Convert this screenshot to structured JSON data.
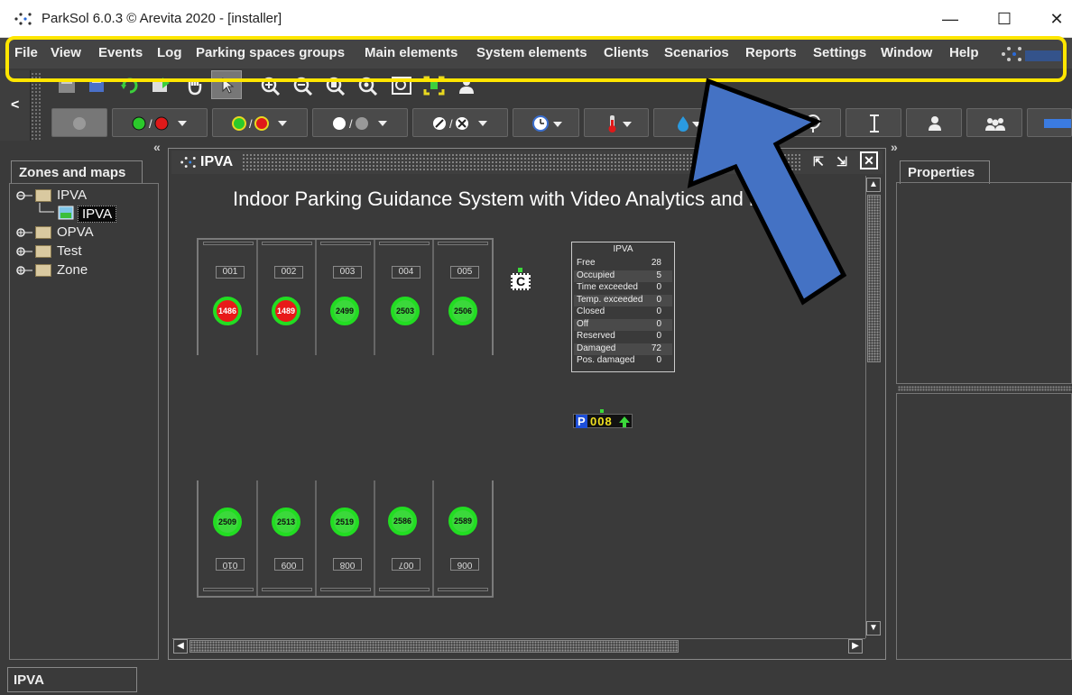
{
  "window": {
    "title": "ParkSol 6.0.3 © Arevita 2020 - [installer]",
    "controls": {
      "minimize": "—",
      "maximize": "☐",
      "close": "✕"
    }
  },
  "menu": {
    "items": [
      "File",
      "View",
      "Events",
      "Log",
      "Parking spaces groups",
      "Main elements",
      "System elements",
      "Clients",
      "Scenarios",
      "Reports",
      "Settings",
      "Window",
      "Help"
    ]
  },
  "side_toggle": {
    "label": "<"
  },
  "zones_panel": {
    "tab": "Zones and maps",
    "tree": [
      {
        "label": "IPVA",
        "children": [
          {
            "label": "IPVA",
            "selected": true
          }
        ]
      },
      {
        "label": "OPVA"
      },
      {
        "label": "Test"
      },
      {
        "label": "Zone"
      }
    ]
  },
  "map_window": {
    "title": "IPVA",
    "heading": "Indoor Parking Guidance System with Video Analytics and LPR",
    "top_slots": [
      {
        "label": "001",
        "sensor": "1486",
        "status": "red"
      },
      {
        "label": "002",
        "sensor": "1489",
        "status": "red"
      },
      {
        "label": "003",
        "sensor": "2499",
        "status": "green"
      },
      {
        "label": "004",
        "sensor": "2503",
        "status": "green"
      },
      {
        "label": "005",
        "sensor": "2506",
        "status": "green"
      }
    ],
    "bottom_slots": [
      {
        "label": "010",
        "sensor": "2509",
        "status": "green"
      },
      {
        "label": "009",
        "sensor": "2513",
        "status": "green"
      },
      {
        "label": "008",
        "sensor": "2519",
        "status": "green"
      },
      {
        "label": "007",
        "sensor": "2586",
        "status": "green"
      },
      {
        "label": "006",
        "sensor": "2589",
        "status": "green"
      }
    ],
    "stats": {
      "title": "IPVA",
      "rows": [
        {
          "label": "Free",
          "value": "28"
        },
        {
          "label": "Occupied",
          "value": "5"
        },
        {
          "label": "Time exceeded",
          "value": "0"
        },
        {
          "label": "Temp. exceeded",
          "value": "0"
        },
        {
          "label": "Closed",
          "value": "0"
        },
        {
          "label": "Off",
          "value": "0"
        },
        {
          "label": "Reserved",
          "value": "0"
        },
        {
          "label": "Damaged",
          "value": "72"
        },
        {
          "label": "Pos. damaged",
          "value": "0"
        }
      ]
    },
    "counter_display": {
      "prefix": "P",
      "value": "008"
    },
    "controller_label": "C"
  },
  "properties_panel": {
    "tab": "Properties"
  },
  "statusbar": {
    "text": "IPVA"
  },
  "colors": {
    "highlight": "#ffe600",
    "arrow": "#4472c4",
    "occupied": "#e81919",
    "free": "#3bd83b"
  }
}
